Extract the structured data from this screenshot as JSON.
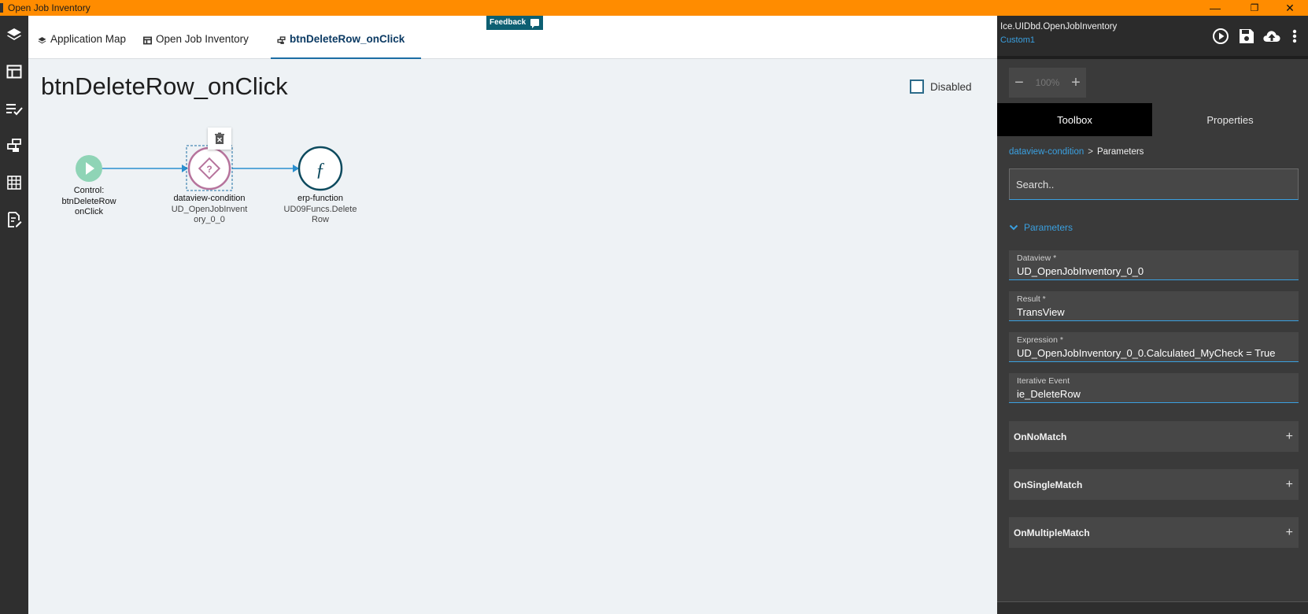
{
  "window": {
    "title": "Open Job Inventory",
    "buttons": {
      "minimize": "—",
      "restore": "❐",
      "close": "✕"
    }
  },
  "rail": {
    "icons": [
      "layers-icon",
      "layout-icon",
      "checklist-icon",
      "workflow-icon",
      "grid-icon",
      "document-edit-icon"
    ]
  },
  "tabs": [
    {
      "label": "Application Map",
      "icon": "layers-icon"
    },
    {
      "label": "Open Job Inventory",
      "icon": "layout-icon"
    },
    {
      "label": "btnDeleteRow_onClick",
      "icon": "workflow-icon",
      "active": true
    }
  ],
  "feedback": {
    "label": "Feedback"
  },
  "canvas": {
    "title": "btnDeleteRow_onClick",
    "disabled_label": "Disabled",
    "disabled_checked": false
  },
  "flow": {
    "nodes": [
      {
        "type": "Control:",
        "lines": [
          "btnDeleteRow",
          "onClick"
        ],
        "color": "#8fd4b6"
      },
      {
        "type": "dataview-condition",
        "lines": [
          "UD_OpenJobInvent",
          "ory_0_0"
        ],
        "color": "#b6739c",
        "selected": true
      },
      {
        "type": "erp-function",
        "lines": [
          "UD09Funcs.Delete",
          "Row"
        ],
        "color": "#0d4a5e"
      }
    ],
    "edge_color": "#2a8fd0"
  },
  "panel": {
    "title": "Ice.UIDbd.OpenJobInventory",
    "subtitle": "Custom1",
    "header_icons": [
      "play-icon",
      "save-icon",
      "cloud-upload-icon",
      "more-icon"
    ],
    "zoom": {
      "minus": "−",
      "value": "100%",
      "plus": "+"
    },
    "tabs": {
      "toolbox": "Toolbox",
      "properties": "Properties"
    },
    "breadcrumb": {
      "link": "dataview-condition",
      "sep": ">",
      "current": "Parameters"
    },
    "search_placeholder": "Search..",
    "section": "Parameters",
    "fields": [
      {
        "label": "Dataview *",
        "value": "UD_OpenJobInventory_0_0"
      },
      {
        "label": "Result *",
        "value": "TransView"
      },
      {
        "label": "Expression *",
        "value": "UD_OpenJobInventory_0_0.Calculated_MyCheck = True"
      },
      {
        "label": "Iterative Event",
        "value": "ie_DeleteRow"
      }
    ],
    "accordions": [
      "OnNoMatch",
      "OnSingleMatch",
      "OnMultipleMatch"
    ],
    "plus": "+"
  },
  "colors": {
    "titlebar": "#ff8c00",
    "accent": "#3aa0e0",
    "panel_bg": "#3a3a3a",
    "rail_bg": "#2f2f2f"
  }
}
